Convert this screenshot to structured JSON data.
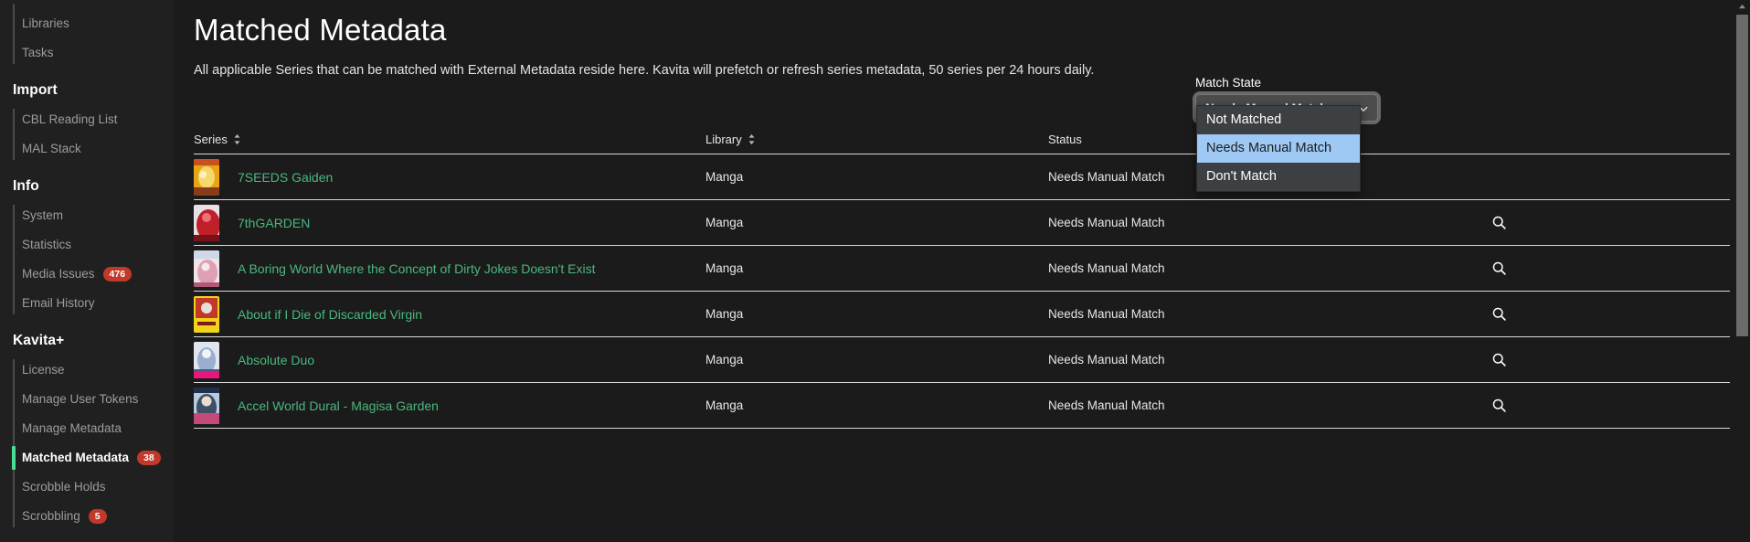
{
  "sidebar": {
    "top_items": [
      {
        "label": "Libraries",
        "badge": null
      },
      {
        "label": "Tasks",
        "badge": null
      }
    ],
    "sections": [
      {
        "title": "Import",
        "items": [
          {
            "label": "CBL Reading List",
            "badge": null
          },
          {
            "label": "MAL Stack",
            "badge": null
          }
        ]
      },
      {
        "title": "Info",
        "items": [
          {
            "label": "System",
            "badge": null
          },
          {
            "label": "Statistics",
            "badge": null
          },
          {
            "label": "Media Issues",
            "badge": "476"
          },
          {
            "label": "Email History",
            "badge": null
          }
        ]
      },
      {
        "title": "Kavita+",
        "items": [
          {
            "label": "License",
            "badge": null
          },
          {
            "label": "Manage User Tokens",
            "badge": null
          },
          {
            "label": "Manage Metadata",
            "badge": null
          },
          {
            "label": "Matched Metadata",
            "badge": "38",
            "active": true
          },
          {
            "label": "Scrobble Holds",
            "badge": null
          },
          {
            "label": "Scrobbling",
            "badge": "5"
          }
        ]
      }
    ],
    "active_accent": "#4ade95",
    "badge_color": "#c0392b"
  },
  "page": {
    "title": "Matched Metadata",
    "description": "All applicable Series that can be matched with External Metadata reside here. Kavita will prefetch or refresh series metadata, 50 series per 24 hours daily."
  },
  "filter": {
    "label": "Match State",
    "selected": "Needs Manual Match",
    "expanded": true,
    "options": [
      {
        "label": "Not Matched",
        "selected": false
      },
      {
        "label": "Needs Manual Match",
        "selected": true
      },
      {
        "label": "Don't Match",
        "selected": false
      }
    ],
    "highlight_color": "#9ec9f5"
  },
  "table": {
    "columns": [
      {
        "key": "series",
        "label": "Series",
        "sortable": true
      },
      {
        "key": "library",
        "label": "Library",
        "sortable": true
      },
      {
        "key": "status",
        "label": "Status",
        "sortable": false
      },
      {
        "key": "action",
        "label": "",
        "sortable": false
      }
    ],
    "rows": [
      {
        "series": "7SEEDS Gaiden",
        "library": "Manga",
        "status": "Needs Manual Match",
        "action_icon": "search-icon"
      },
      {
        "series": "7thGARDEN",
        "library": "Manga",
        "status": "Needs Manual Match",
        "action_icon": "search-icon"
      },
      {
        "series": "A Boring World Where the Concept of Dirty Jokes Doesn't Exist",
        "library": "Manga",
        "status": "Needs Manual Match",
        "action_icon": "search-icon"
      },
      {
        "series": "About if I Die of Discarded Virgin",
        "library": "Manga",
        "status": "Needs Manual Match",
        "action_icon": "search-icon"
      },
      {
        "series": "Absolute Duo",
        "library": "Manga",
        "status": "Needs Manual Match",
        "action_icon": "search-icon"
      },
      {
        "series": "Accel World Dural - Magisa Garden",
        "library": "Manga",
        "status": "Needs Manual Match",
        "action_icon": "search-icon"
      }
    ],
    "link_color": "#4ab87e"
  },
  "thumbnails": [
    {
      "c1": "#e8a317",
      "c2": "#c9511f",
      "c3": "#f5d76e",
      "c4": "#8b3a1a"
    },
    {
      "c1": "#e8e0e4",
      "c2": "#c0202a",
      "c3": "#f0707a",
      "c4": "#7a1018"
    },
    {
      "c1": "#efe3e6",
      "c2": "#e0a0b4",
      "c3": "#cfd8e8",
      "c4": "#b05878"
    },
    {
      "c1": "#f2d21a",
      "c2": "#c0392b",
      "c3": "#e8e0d8",
      "c4": "#7a1f18"
    },
    {
      "c1": "#dfe4ee",
      "c2": "#9aaed0",
      "c3": "#e8187a",
      "c4": "#4a5a80"
    },
    {
      "c1": "#b8cadd",
      "c2": "#3e5068",
      "c3": "#c44a7a",
      "c4": "#20304a"
    }
  ]
}
